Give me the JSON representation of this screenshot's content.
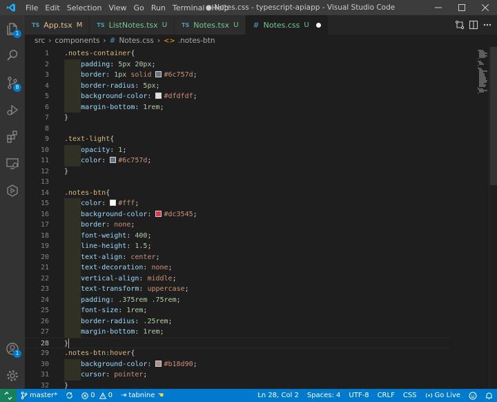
{
  "window": {
    "title": "● Notes.css - typescript-apiapp - Visual Studio Code",
    "menu": [
      "File",
      "Edit",
      "Selection",
      "View",
      "Go",
      "Run",
      "Terminal",
      "Help"
    ]
  },
  "activity_bar": {
    "items": [
      {
        "icon": "explorer-icon",
        "badge": "1"
      },
      {
        "icon": "search-icon",
        "badge": ""
      },
      {
        "icon": "source-control-icon",
        "badge": "8"
      },
      {
        "icon": "run-debug-icon",
        "badge": ""
      },
      {
        "icon": "extensions-icon",
        "badge": ""
      },
      {
        "icon": "remote-explorer-icon",
        "badge": ""
      },
      {
        "icon": "extension-view-icon",
        "badge": ""
      }
    ],
    "bottom": [
      {
        "icon": "accounts-icon",
        "badge": "1"
      },
      {
        "icon": "manage-gear-icon",
        "badge": ""
      }
    ]
  },
  "tabs": [
    {
      "prefix": "TS",
      "name": "App.tsx",
      "status": "M",
      "active": false
    },
    {
      "prefix": "TS",
      "name": "ListNotes.tsx",
      "status": "U",
      "active": false
    },
    {
      "prefix": "TS",
      "name": "Notes.tsx",
      "status": "U",
      "active": false
    },
    {
      "prefix": "#",
      "name": "Notes.css",
      "status": "U",
      "active": true
    }
  ],
  "breadcrumb": {
    "parts": [
      "src",
      "components",
      "Notes.css",
      ".notes-btn"
    ]
  },
  "editor": {
    "lines": [
      {
        "n": "1",
        "indent": false,
        "tokens": [
          {
            "t": ".notes-container",
            "c": "sel"
          },
          {
            "t": "{",
            "c": "punc"
          }
        ]
      },
      {
        "n": "2",
        "indent": true,
        "tokens": [
          {
            "t": "padding",
            "c": "prop"
          },
          {
            "t": ": ",
            "c": "punc"
          },
          {
            "t": "5px 20px",
            "c": "num"
          },
          {
            "t": ";",
            "c": "punc"
          }
        ]
      },
      {
        "n": "3",
        "indent": true,
        "tokens": [
          {
            "t": "border",
            "c": "prop"
          },
          {
            "t": ": ",
            "c": "punc"
          },
          {
            "t": "1px ",
            "c": "num"
          },
          {
            "t": "solid ",
            "c": "kw"
          },
          {
            "sw": "#6c757d"
          },
          {
            "t": "#6c757d",
            "c": "kw"
          },
          {
            "t": ";",
            "c": "punc"
          }
        ]
      },
      {
        "n": "4",
        "indent": true,
        "tokens": [
          {
            "t": "border-radius",
            "c": "prop"
          },
          {
            "t": ": ",
            "c": "punc"
          },
          {
            "t": "5px",
            "c": "num"
          },
          {
            "t": ";",
            "c": "punc"
          }
        ]
      },
      {
        "n": "5",
        "indent": true,
        "tokens": [
          {
            "t": "background-color",
            "c": "prop"
          },
          {
            "t": ": ",
            "c": "punc"
          },
          {
            "sw": "#dfdfdf"
          },
          {
            "t": "#dfdfdf",
            "c": "kw"
          },
          {
            "t": ";",
            "c": "punc"
          }
        ]
      },
      {
        "n": "6",
        "indent": true,
        "tokens": [
          {
            "t": "margin-bottom",
            "c": "prop"
          },
          {
            "t": ": ",
            "c": "punc"
          },
          {
            "t": "1rem",
            "c": "num"
          },
          {
            "t": ";",
            "c": "punc"
          }
        ]
      },
      {
        "n": "7",
        "indent": false,
        "tokens": [
          {
            "t": "}",
            "c": "punc"
          }
        ]
      },
      {
        "n": "8",
        "indent": false,
        "tokens": []
      },
      {
        "n": "9",
        "indent": false,
        "tokens": [
          {
            "t": ".text-light",
            "c": "sel"
          },
          {
            "t": "{",
            "c": "punc"
          }
        ]
      },
      {
        "n": "10",
        "indent": true,
        "tokens": [
          {
            "t": "opacity",
            "c": "prop"
          },
          {
            "t": ": ",
            "c": "punc"
          },
          {
            "t": "1",
            "c": "num"
          },
          {
            "t": ";",
            "c": "punc"
          }
        ]
      },
      {
        "n": "11",
        "indent": true,
        "tokens": [
          {
            "t": "color",
            "c": "prop"
          },
          {
            "t": ": ",
            "c": "punc"
          },
          {
            "sw": "#6c757d"
          },
          {
            "t": "#6c757d",
            "c": "kw"
          },
          {
            "t": ";",
            "c": "punc"
          }
        ]
      },
      {
        "n": "12",
        "indent": false,
        "tokens": [
          {
            "t": "}",
            "c": "punc"
          }
        ]
      },
      {
        "n": "13",
        "indent": false,
        "tokens": []
      },
      {
        "n": "14",
        "indent": false,
        "tokens": [
          {
            "t": ".notes-btn",
            "c": "sel"
          },
          {
            "t": "{",
            "c": "punc"
          }
        ]
      },
      {
        "n": "15",
        "indent": true,
        "tokens": [
          {
            "t": "color",
            "c": "prop"
          },
          {
            "t": ": ",
            "c": "punc"
          },
          {
            "sw": "#ffffff"
          },
          {
            "t": "#fff",
            "c": "kw"
          },
          {
            "t": ";",
            "c": "punc"
          }
        ]
      },
      {
        "n": "16",
        "indent": true,
        "tokens": [
          {
            "t": "background-color",
            "c": "prop"
          },
          {
            "t": ": ",
            "c": "punc"
          },
          {
            "sw": "#dc3545"
          },
          {
            "t": "#dc3545",
            "c": "kw"
          },
          {
            "t": ";",
            "c": "punc"
          }
        ]
      },
      {
        "n": "17",
        "indent": true,
        "tokens": [
          {
            "t": "border",
            "c": "prop"
          },
          {
            "t": ": ",
            "c": "punc"
          },
          {
            "t": "none",
            "c": "kw"
          },
          {
            "t": ";",
            "c": "punc"
          }
        ]
      },
      {
        "n": "18",
        "indent": true,
        "tokens": [
          {
            "t": "font-weight",
            "c": "prop"
          },
          {
            "t": ": ",
            "c": "punc"
          },
          {
            "t": "400",
            "c": "num"
          },
          {
            "t": ";",
            "c": "punc"
          }
        ]
      },
      {
        "n": "19",
        "indent": true,
        "tokens": [
          {
            "t": "line-height",
            "c": "prop"
          },
          {
            "t": ": ",
            "c": "punc"
          },
          {
            "t": "1.5",
            "c": "num"
          },
          {
            "t": ";",
            "c": "punc"
          }
        ]
      },
      {
        "n": "20",
        "indent": true,
        "tokens": [
          {
            "t": "text-align",
            "c": "prop"
          },
          {
            "t": ": ",
            "c": "punc"
          },
          {
            "t": "center",
            "c": "kw"
          },
          {
            "t": ";",
            "c": "punc"
          }
        ]
      },
      {
        "n": "21",
        "indent": true,
        "tokens": [
          {
            "t": "text-decoration",
            "c": "prop"
          },
          {
            "t": ": ",
            "c": "punc"
          },
          {
            "t": "none",
            "c": "kw"
          },
          {
            "t": ";",
            "c": "punc"
          }
        ]
      },
      {
        "n": "22",
        "indent": true,
        "tokens": [
          {
            "t": "vertical-align",
            "c": "prop"
          },
          {
            "t": ": ",
            "c": "punc"
          },
          {
            "t": "middle",
            "c": "kw"
          },
          {
            "t": ";",
            "c": "punc"
          }
        ]
      },
      {
        "n": "23",
        "indent": true,
        "tokens": [
          {
            "t": "text-transform",
            "c": "prop"
          },
          {
            "t": ": ",
            "c": "punc"
          },
          {
            "t": "uppercase",
            "c": "kw"
          },
          {
            "t": ";",
            "c": "punc"
          }
        ]
      },
      {
        "n": "24",
        "indent": true,
        "tokens": [
          {
            "t": "padding",
            "c": "prop"
          },
          {
            "t": ": ",
            "c": "punc"
          },
          {
            "t": ".375rem .75rem",
            "c": "num"
          },
          {
            "t": ";",
            "c": "punc"
          }
        ]
      },
      {
        "n": "25",
        "indent": true,
        "tokens": [
          {
            "t": "font-size",
            "c": "prop"
          },
          {
            "t": ": ",
            "c": "punc"
          },
          {
            "t": "1rem",
            "c": "num"
          },
          {
            "t": ";",
            "c": "punc"
          }
        ]
      },
      {
        "n": "26",
        "indent": true,
        "tokens": [
          {
            "t": "border-radius",
            "c": "prop"
          },
          {
            "t": ": ",
            "c": "punc"
          },
          {
            "t": ".25rem",
            "c": "num"
          },
          {
            "t": ";",
            "c": "punc"
          }
        ]
      },
      {
        "n": "27",
        "indent": true,
        "tokens": [
          {
            "t": "margin-bottom",
            "c": "prop"
          },
          {
            "t": ": ",
            "c": "punc"
          },
          {
            "t": "1rem",
            "c": "num"
          },
          {
            "t": ";",
            "c": "punc"
          }
        ]
      },
      {
        "n": "28",
        "indent": false,
        "tokens": [
          {
            "t": "}",
            "c": "punc"
          }
        ],
        "current": true
      },
      {
        "n": "29",
        "indent": false,
        "tokens": [
          {
            "t": ".notes-btn:hover",
            "c": "sel"
          },
          {
            "t": "{",
            "c": "punc"
          }
        ]
      },
      {
        "n": "30",
        "indent": true,
        "tokens": [
          {
            "t": "background-color",
            "c": "prop"
          },
          {
            "t": ": ",
            "c": "punc"
          },
          {
            "sw": "#b18d90"
          },
          {
            "t": "#b18d90",
            "c": "kw"
          },
          {
            "t": ";",
            "c": "punc"
          }
        ]
      },
      {
        "n": "31",
        "indent": true,
        "tokens": [
          {
            "t": "cursor",
            "c": "prop"
          },
          {
            "t": ": ",
            "c": "punc"
          },
          {
            "t": "pointer",
            "c": "kw"
          },
          {
            "t": ";",
            "c": "punc"
          }
        ]
      },
      {
        "n": "32",
        "indent": false,
        "tokens": [
          {
            "t": "}",
            "c": "punc"
          }
        ]
      }
    ]
  },
  "status_bar": {
    "branch": "master*",
    "errors": "0",
    "warnings": "0",
    "tabnine": "tabnine",
    "position": "Ln 28, Col 2",
    "spaces": "Spaces: 4",
    "encoding": "UTF-8",
    "eol": "CRLF",
    "language": "CSS",
    "golive": "Go Live"
  },
  "colors": {
    "accent": "#007acc",
    "remote": "#16825d",
    "ts_icon": "#519aba",
    "modified": "#e2c08d",
    "untracked": "#73c991"
  }
}
